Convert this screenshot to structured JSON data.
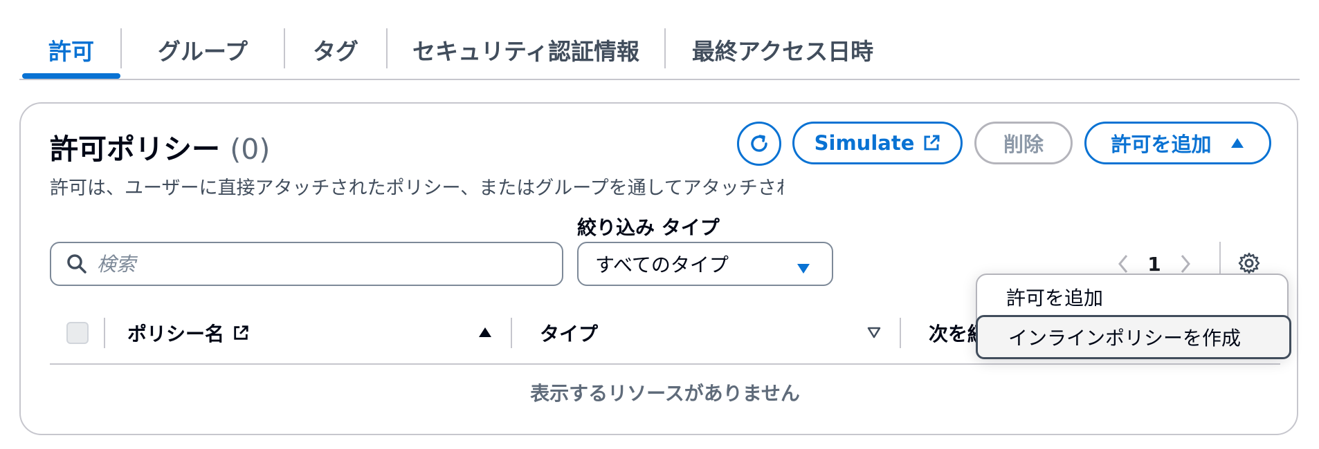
{
  "tabs": [
    {
      "label": "許可",
      "active": true
    },
    {
      "label": "グループ",
      "active": false
    },
    {
      "label": "タグ",
      "active": false
    },
    {
      "label": "セキュリティ認証情報",
      "active": false
    },
    {
      "label": "最終アクセス日時",
      "active": false
    }
  ],
  "panel": {
    "title": "許可ポリシー",
    "count": "(0)",
    "description": "許可は、ユーザーに直接アタッチされたポリシー、またはグループを通してアタッチされたポリシーで定義",
    "buttons": {
      "refresh_icon": "refresh-icon",
      "simulate": "Simulate",
      "delete": "削除",
      "add": "許可を追加"
    },
    "filter_label": "絞り込み タイプ",
    "search": {
      "placeholder": "検索",
      "value": ""
    },
    "type_select": {
      "selected": "すべてのタイプ"
    },
    "pagination": {
      "page": "1"
    },
    "table": {
      "columns": [
        "ポリシー名",
        "タイプ",
        "次を経由してアタッチ"
      ],
      "empty_message": "表示するリソースがありません"
    }
  },
  "dropdown": {
    "items": [
      "許可を追加",
      "インラインポリシーを作成"
    ]
  },
  "colors": {
    "accent": "#0972d3",
    "border": "#c6c6cd",
    "text": "#000716",
    "muted": "#5f6b7a"
  }
}
